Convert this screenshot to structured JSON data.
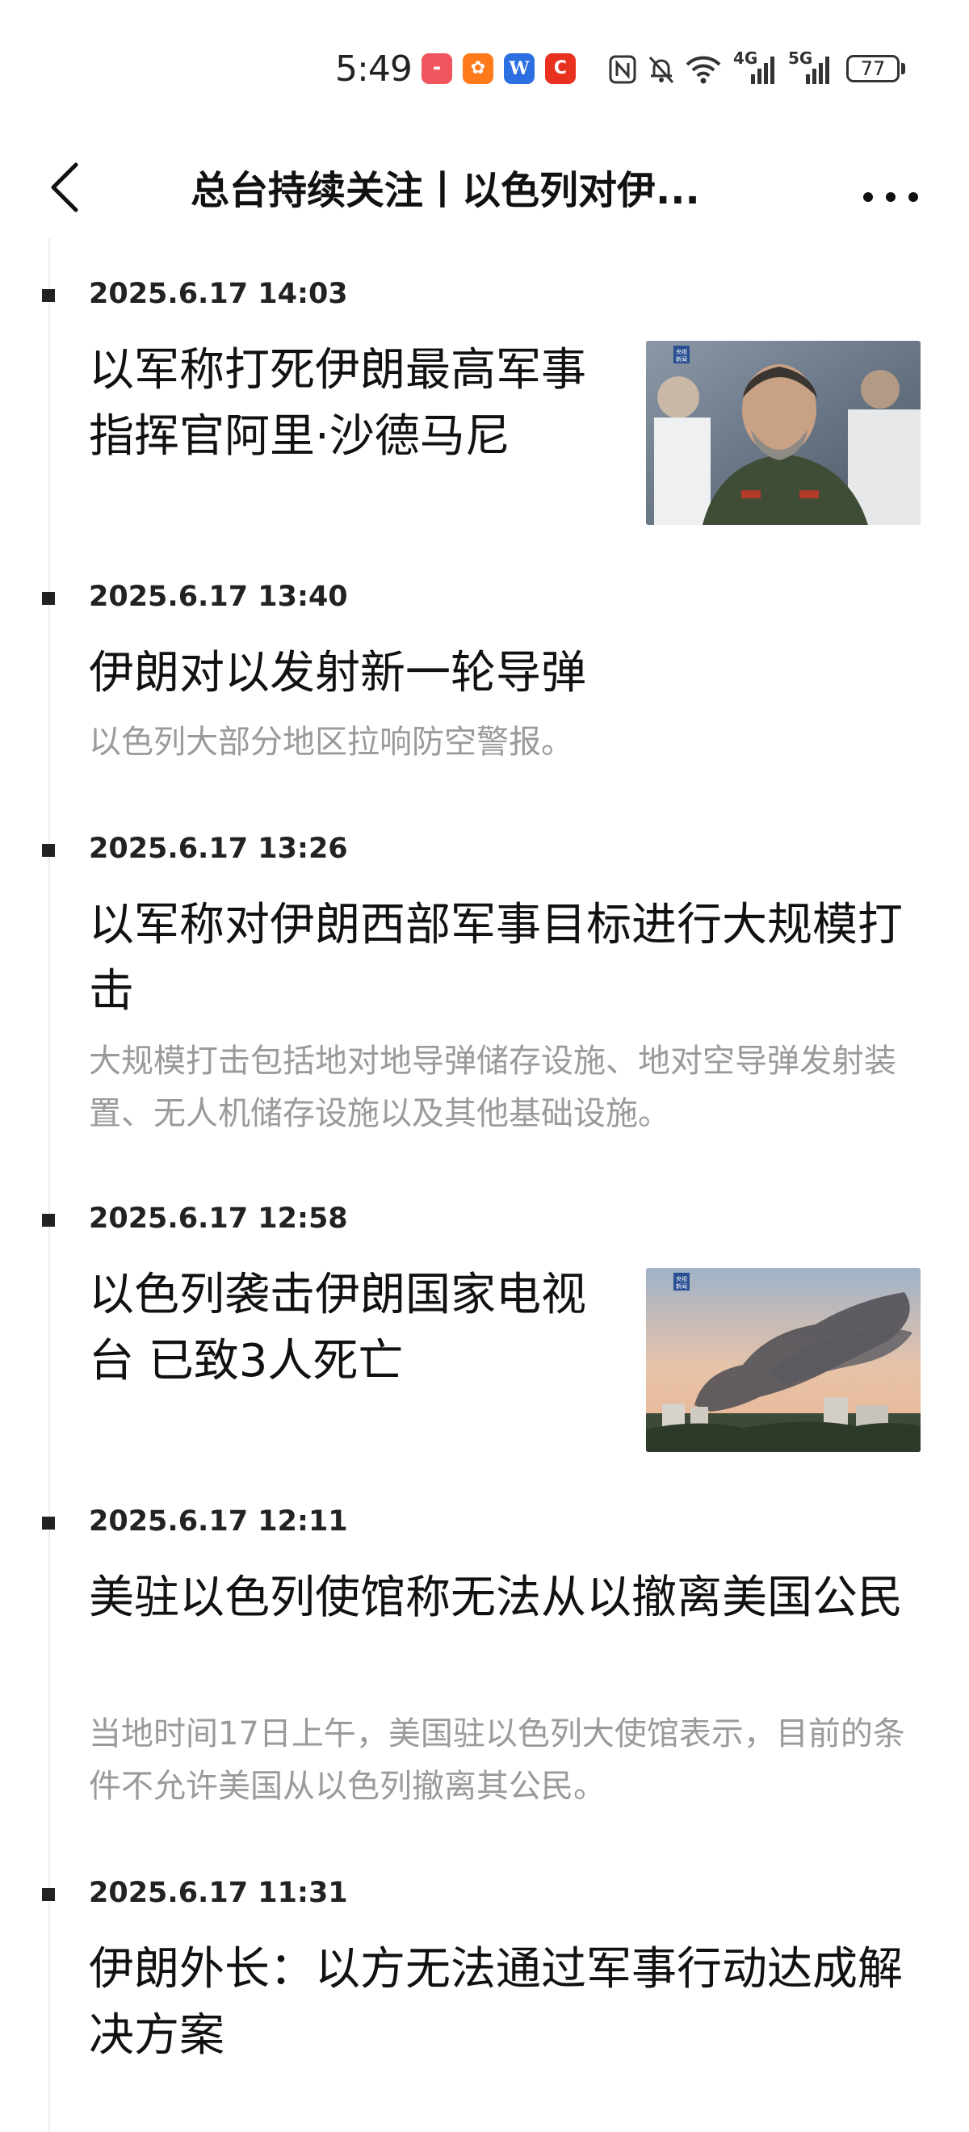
{
  "status_bar": {
    "time": "5:49",
    "app_icons": [
      "huawei-app-icon",
      "shopping-app-icon",
      "word-app-icon",
      "c-app-icon"
    ],
    "system_icons": [
      "nfc-icon",
      "mute-icon",
      "wifi-icon",
      "4g-signal-icon",
      "5g-signal-icon"
    ],
    "network_4g": "4G",
    "network_5g": "5G",
    "battery": "77"
  },
  "header": {
    "title": "总台持续关注丨以色列对伊..."
  },
  "entries": [
    {
      "time": "2025.6.17 14:03",
      "headline": "以军称打死伊朗最高军事指挥官阿里·沙德马尼",
      "has_image": true,
      "image_watermark": "央视新闻"
    },
    {
      "time": "2025.6.17 13:40",
      "headline": "伊朗对以发射新一轮导弹",
      "summary": "以色列大部分地区拉响防空警报。"
    },
    {
      "time": "2025.6.17 13:26",
      "headline": "以军称对伊朗西部军事目标进行大规模打击",
      "summary": "大规模打击包括地对地导弹储存设施、地对空导弹发射装置、无人机储存设施以及其他基础设施。"
    },
    {
      "time": "2025.6.17 12:58",
      "headline": "以色列袭击伊朗国家电视台 已致3人死亡",
      "has_image": true,
      "image_watermark": "央视新闻"
    },
    {
      "time": "2025.6.17 12:11",
      "headline": "美驻以色列使馆称无法从以撤离美国公民",
      "summary": "当地时间17日上午，美国驻以色列大使馆表示，目前的条件不允许美国从以色列撤离其公民。"
    },
    {
      "time": "2025.6.17 11:31",
      "headline": "伊朗外长：以方无法通过军事行动达成解决方案"
    }
  ]
}
